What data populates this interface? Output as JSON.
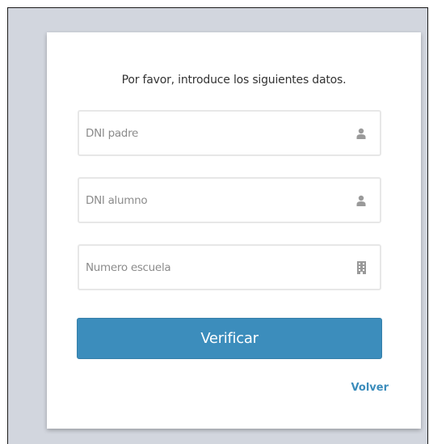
{
  "form": {
    "intro_text": "Por favor, introduce los siguientes datos.",
    "fields": [
      {
        "placeholder": "DNI padre",
        "value": "",
        "icon": "user-icon"
      },
      {
        "placeholder": "DNI alumno",
        "value": "",
        "icon": "user-icon"
      },
      {
        "placeholder": "Numero escuela",
        "value": "",
        "icon": "building-icon"
      }
    ],
    "submit_label": "Verificar",
    "back_link": "Volver"
  },
  "colors": {
    "page_background": "#d2d6de",
    "card_background": "#ffffff",
    "accent": "#3c8dbc",
    "icon_gray": "#9a9a9a"
  }
}
